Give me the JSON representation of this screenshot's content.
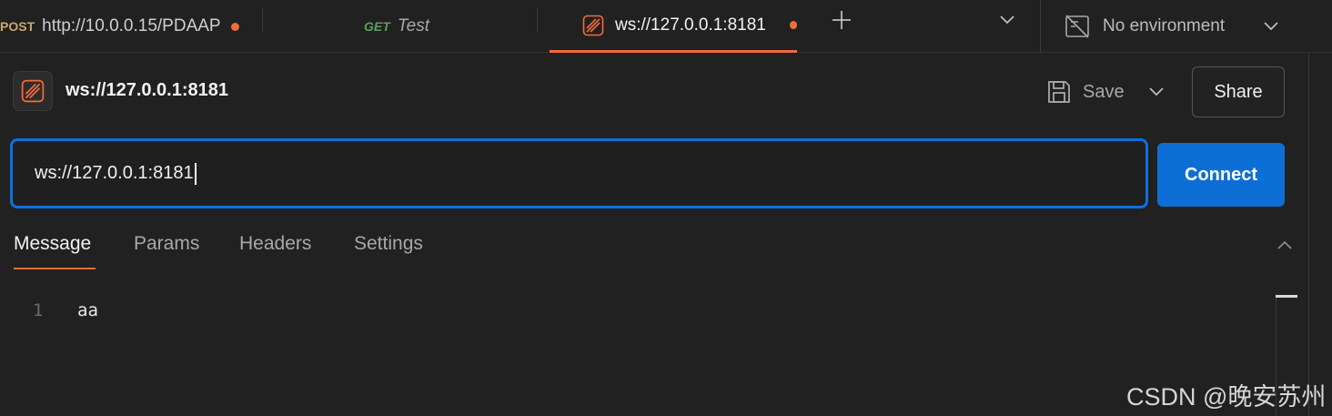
{
  "tabs": [
    {
      "method": "POST",
      "method_color": "#c9a96b",
      "label": "http://10.0.0.15/PDAAP",
      "unsaved": true
    },
    {
      "method": "GET",
      "method_color": "#5aa05a",
      "label": "Test",
      "unsaved": false
    },
    {
      "method": "",
      "label": "ws://127.0.0.1:8181",
      "unsaved": true,
      "active": true
    }
  ],
  "environment": {
    "label": "No environment"
  },
  "request": {
    "title": "ws://127.0.0.1:8181",
    "save_label": "Save",
    "share_label": "Share"
  },
  "url_bar": {
    "value": "ws://127.0.0.1:8181",
    "connect_label": "Connect"
  },
  "subtabs": [
    {
      "label": "Message",
      "active": true
    },
    {
      "label": "Params"
    },
    {
      "label": "Headers"
    },
    {
      "label": "Settings"
    }
  ],
  "editor": {
    "lines": [
      {
        "number": "1",
        "text": "aa"
      }
    ]
  },
  "watermark": "CSDN @晚安苏州",
  "colors": {
    "accent": "#f26b3a",
    "primary": "#0d6fd6",
    "focus": "#0d6fe0",
    "background": "#212121"
  }
}
